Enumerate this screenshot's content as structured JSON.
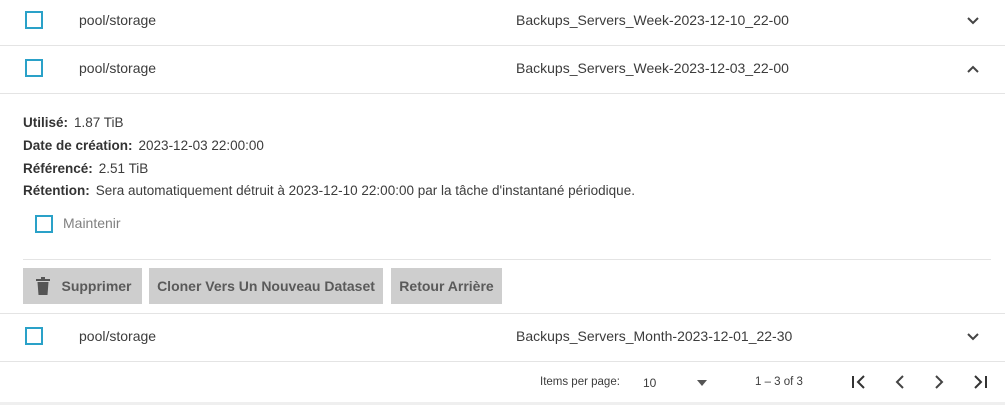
{
  "rows": [
    {
      "dataset": "pool/storage",
      "snapshot": "Backups_Servers_Week-2023-12-10_22-00",
      "expanded": false
    },
    {
      "dataset": "pool/storage",
      "snapshot": "Backups_Servers_Week-2023-12-03_22-00",
      "expanded": true
    },
    {
      "dataset": "pool/storage",
      "snapshot": "Backups_Servers_Month-2023-12-01_22-30",
      "expanded": false
    }
  ],
  "details": {
    "used_label": "Utilisé:",
    "used_value": "1.87 TiB",
    "created_label": "Date de création:",
    "created_value": "2023-12-03 22:00:00",
    "referenced_label": "Référencé:",
    "referenced_value": "2.51 TiB",
    "retention_label": "Rétention:",
    "retention_value": "Sera automatiquement détruit à 2023-12-10 22:00:00 par la tâche d'instantané périodique.",
    "keep_label": "Maintenir"
  },
  "actions": {
    "delete_label": "Supprimer",
    "clone_label": "Cloner Vers Un Nouveau Dataset",
    "rollback_label": "Retour Arrière"
  },
  "paginator": {
    "items_per_page_label": "Items per page:",
    "items_per_page_value": "10",
    "range_label": "1 – 3 of 3"
  },
  "colors": {
    "checkbox": "#2aa1c8",
    "button_bg": "#cecece"
  }
}
